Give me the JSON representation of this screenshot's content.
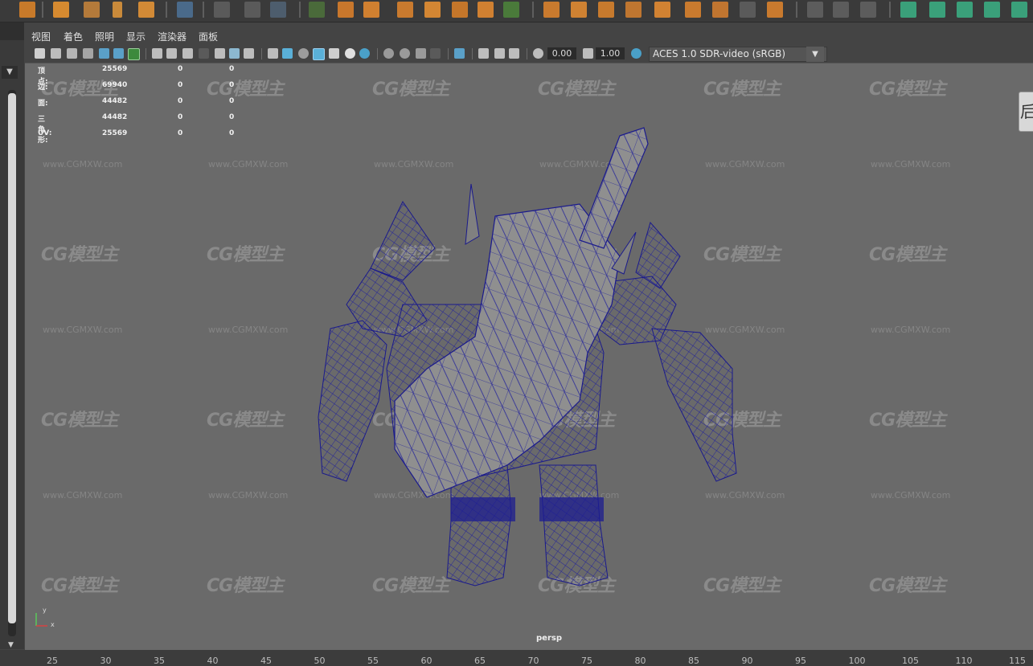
{
  "menus": [
    "视图",
    "着色",
    "照明",
    "显示",
    "渲染器",
    "面板"
  ],
  "toolbar": {
    "field_value_1": "0.00",
    "field_value_2": "1.00",
    "color_space": "ACES 1.0 SDR-video (sRGB)"
  },
  "hud_stats": [
    {
      "label": "顶点:",
      "value": "25569",
      "sel": "0",
      "uv": "0"
    },
    {
      "label": "边:",
      "value": "69940",
      "sel": "0",
      "uv": "0"
    },
    {
      "label": "面:",
      "value": "44482",
      "sel": "0",
      "uv": "0"
    },
    {
      "label": "三角形:",
      "value": "44482",
      "sel": "0",
      "uv": "0"
    },
    {
      "label": "UV:",
      "value": "25569",
      "sel": "0",
      "uv": "0"
    }
  ],
  "viewport": {
    "camera": "persp",
    "watermark": "CG模型主",
    "watermark_url": "www.CGMXW.com",
    "wire_color": "#1a1a8c",
    "mesh_color": "#8c8c8c"
  },
  "side_tab_glyph": "后",
  "axis": {
    "y": "y",
    "x": "x"
  },
  "timeline_ticks": [
    "25",
    "30",
    "35",
    "40",
    "45",
    "50",
    "55",
    "60",
    "65",
    "70",
    "75",
    "80",
    "85",
    "90",
    "95",
    "100",
    "105",
    "110",
    "115"
  ]
}
